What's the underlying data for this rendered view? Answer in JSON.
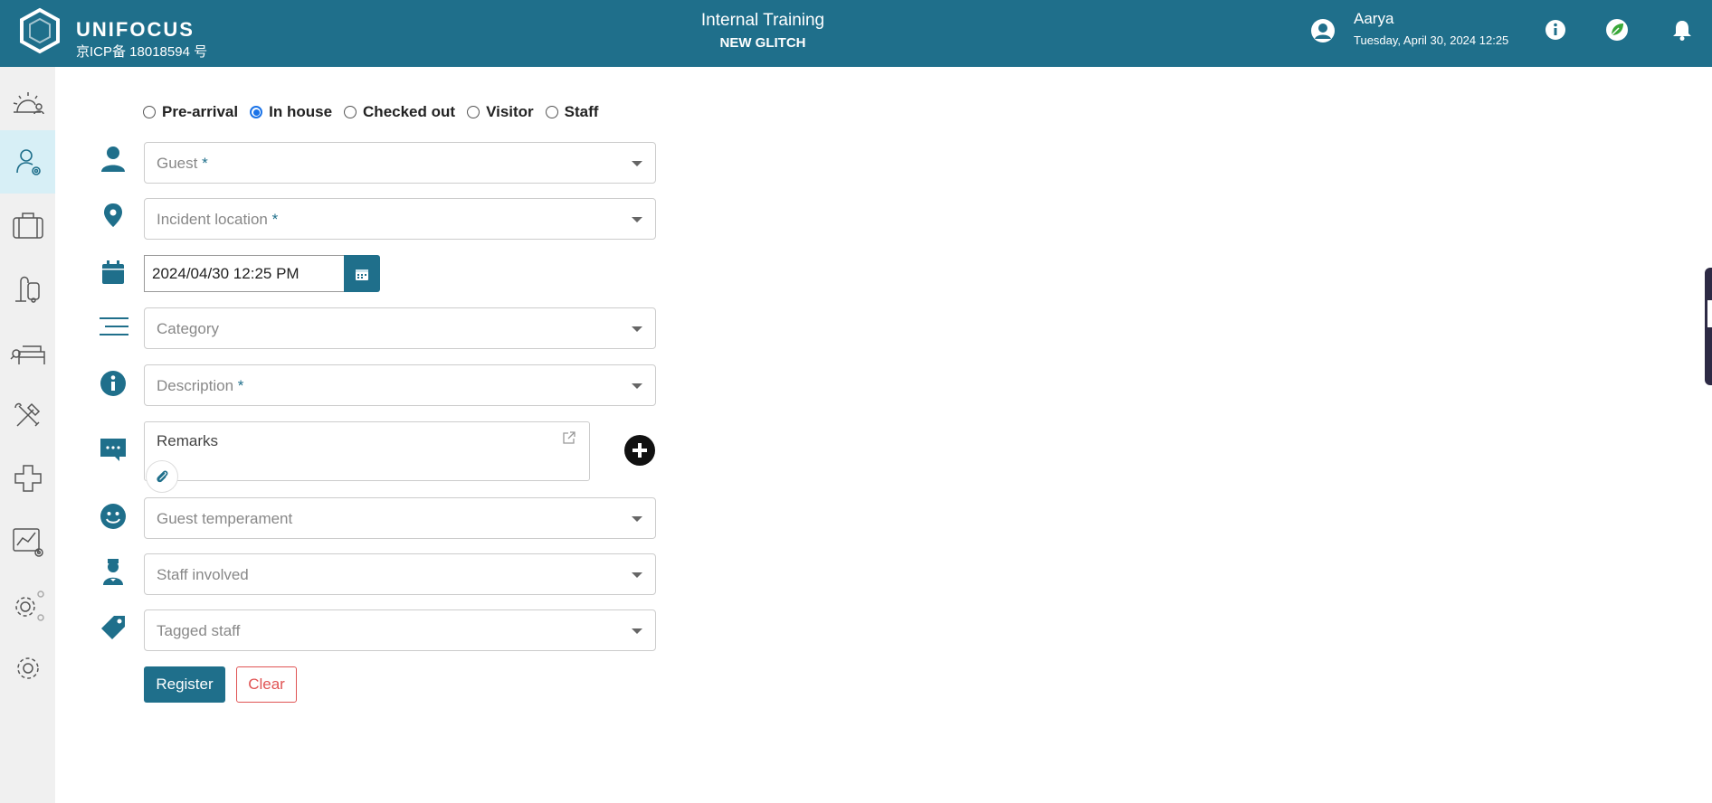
{
  "header": {
    "brand": "UNIFOCUS",
    "brand_sub": "京ICP备 18018594 号",
    "title": "Internal Training",
    "subtitle": "NEW GLITCH",
    "user_name": "Aarya",
    "user_date": "Tuesday, April 30, 2024 12:25",
    "colors": {
      "bar": "#1f6f8b",
      "leaf_icon": "#3aa83a"
    },
    "icons": [
      "user-circle-icon",
      "info-icon",
      "leaf-icon",
      "bell-icon"
    ]
  },
  "sidebar": {
    "items": [
      {
        "icon": "sunrise-guest-icon",
        "active": false
      },
      {
        "icon": "guest-settings-icon",
        "active": true
      },
      {
        "icon": "luggage-icon",
        "active": false
      },
      {
        "icon": "vacuum-icon",
        "active": false
      },
      {
        "icon": "bed-search-icon",
        "active": false
      },
      {
        "icon": "tools-icon",
        "active": false
      },
      {
        "icon": "medical-cross-icon",
        "active": false
      },
      {
        "icon": "chart-settings-icon",
        "active": false
      },
      {
        "icon": "gears-icon",
        "active": false
      },
      {
        "icon": "settings-icon",
        "active": false
      }
    ]
  },
  "form": {
    "status_options": [
      {
        "label": "Pre-arrival",
        "checked": false
      },
      {
        "label": "In house",
        "checked": true
      },
      {
        "label": "Checked out",
        "checked": false
      },
      {
        "label": "Visitor",
        "checked": false
      },
      {
        "label": "Staff",
        "checked": false
      }
    ],
    "guest_placeholder": "Guest",
    "location_placeholder": "Incident location",
    "required_mark": "*",
    "datetime_value": "2024/04/30 12:25 PM",
    "category_placeholder": "Category",
    "description_placeholder": "Description",
    "remarks_label": "Remarks",
    "temperament_placeholder": "Guest temperament",
    "staff_involved_placeholder": "Staff involved",
    "tagged_staff_placeholder": "Tagged staff",
    "register_label": "Register",
    "clear_label": "Clear",
    "accent_color": "#1f6f8b",
    "clear_color": "#e05454"
  }
}
